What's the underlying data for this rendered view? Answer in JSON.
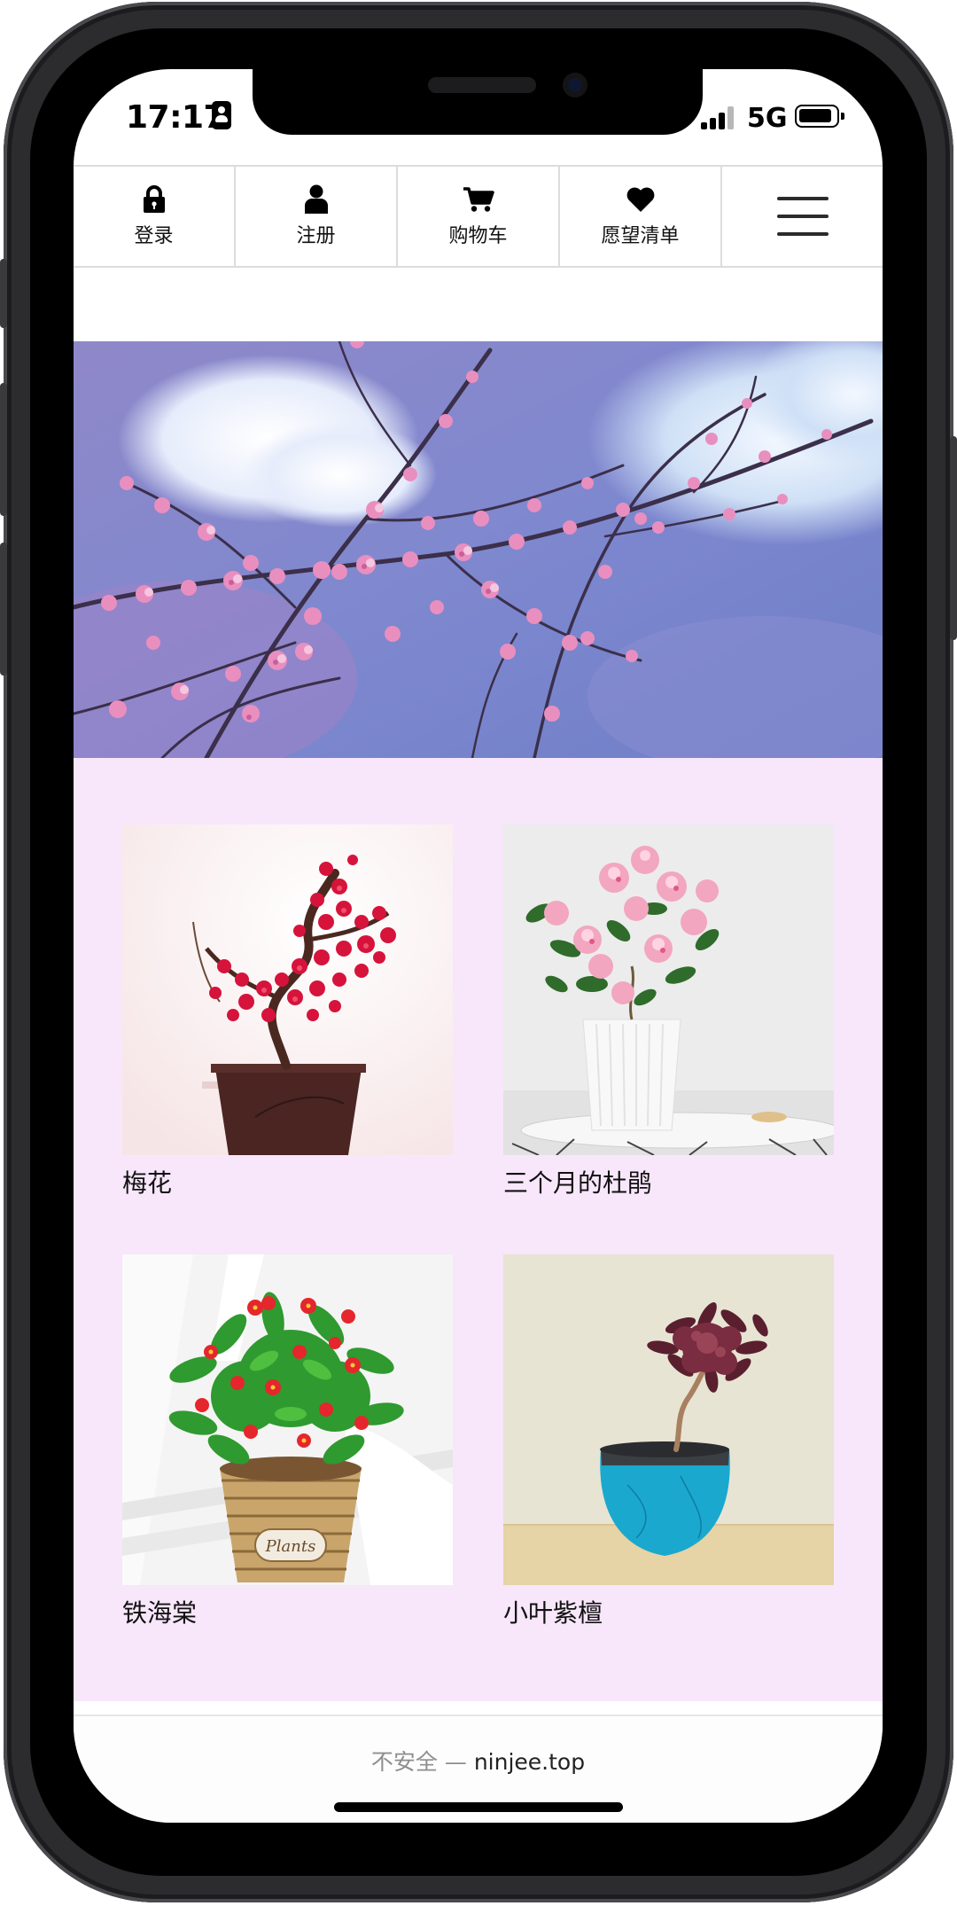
{
  "status": {
    "time": "17:17",
    "network": "5G"
  },
  "nav": {
    "login": "登录",
    "register": "注册",
    "cart": "购物车",
    "wishlist": "愿望清单"
  },
  "products": [
    {
      "name": "梅花"
    },
    {
      "name": "三个月的杜鹃"
    },
    {
      "name": "铁海棠"
    },
    {
      "name": "小叶紫檀"
    }
  ],
  "browser": {
    "security": "不安全",
    "separator": " — ",
    "domain": "ninjee.top"
  },
  "colors": {
    "product_bg": "#f8e6fb",
    "blossom": "#e98fbf"
  }
}
